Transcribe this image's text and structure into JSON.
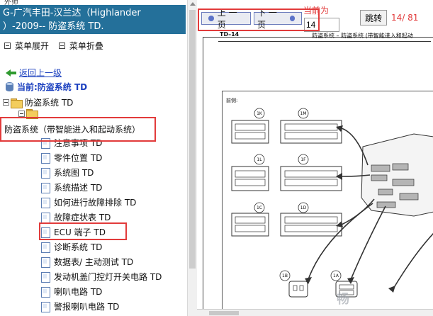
{
  "left_pane": {
    "top_strip": "外师",
    "title_line1": "G-广汽丰田-汉兰达（Highlander",
    "title_line2": "）-2009-- 防盗系统 TD.",
    "menu_expand": "菜单展开",
    "menu_collapse": "菜单折叠",
    "back_link": "返回上一级",
    "current": "当前:防盗系统 TD",
    "root_node": "防盗系统 TD",
    "system_node": "防盗系统（带智能进入和起动系统）",
    "leaves": [
      "注意事项 TD",
      "零件位置 TD",
      "系统图 TD",
      "系统描述 TD",
      "如何进行故障排除 TD",
      "故障症状表 TD",
      "ECU 端子 TD",
      "诊断系统 TD",
      "数据表/ 主动测试 TD",
      "发动机盖门控灯开关电路 TD",
      "喇叭电路 TD",
      "警报喇叭电路 TD"
    ]
  },
  "toolbar": {
    "prev": "上 一 页",
    "next": "下 一 页",
    "current_label": "当前为",
    "page_value": "14",
    "jump": "跳转",
    "page_count": "14/ 81"
  },
  "document": {
    "code": "TD–14",
    "header": "防盗系统 – 防盗系统 (带智能进入和起动",
    "front_label": "前侧:",
    "connectors": [
      "1K",
      "1M",
      "1L",
      "1F",
      "1C",
      "1D",
      "1B",
      "1A"
    ],
    "watermark": "畅"
  },
  "colors": {
    "title_bg": "#24709a",
    "highlight": "#e23b3b",
    "link": "#1a3fbf"
  }
}
